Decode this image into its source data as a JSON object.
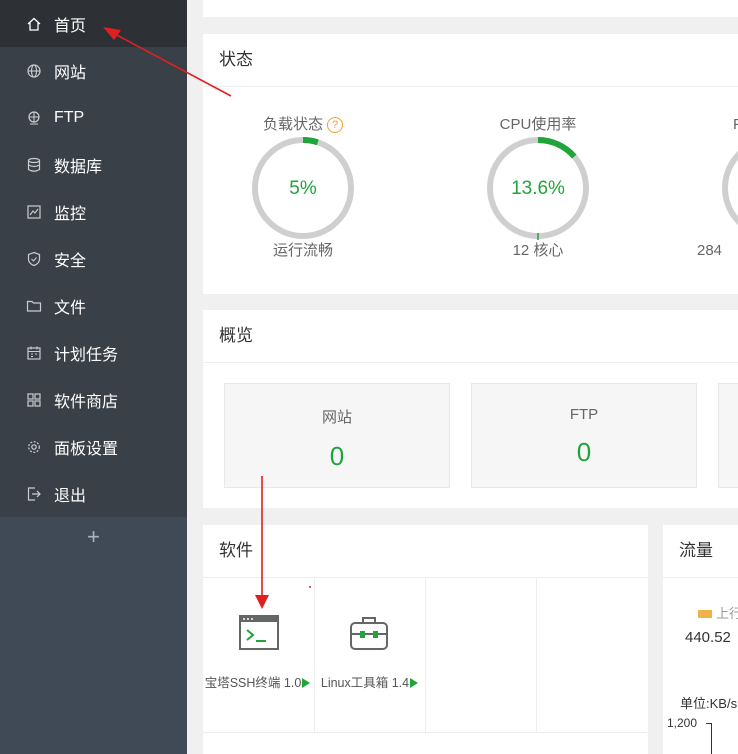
{
  "sidebar": {
    "items": [
      {
        "label": "首页",
        "icon": "home-icon"
      },
      {
        "label": "网站",
        "icon": "globe-icon"
      },
      {
        "label": "FTP",
        "icon": "ftp-icon"
      },
      {
        "label": "数据库",
        "icon": "database-icon"
      },
      {
        "label": "监控",
        "icon": "monitor-icon"
      },
      {
        "label": "安全",
        "icon": "shield-icon"
      },
      {
        "label": "文件",
        "icon": "folder-icon"
      },
      {
        "label": "计划任务",
        "icon": "calendar-icon"
      },
      {
        "label": "软件商店",
        "icon": "grid-icon"
      },
      {
        "label": "面板设置",
        "icon": "gear-icon"
      },
      {
        "label": "退出",
        "icon": "logout-icon"
      }
    ],
    "add_label": "+"
  },
  "status": {
    "title": "状态",
    "load": {
      "label": "负载状态",
      "help": "?",
      "value": "5%",
      "sub": "运行流畅",
      "percent": 5
    },
    "cpu": {
      "label": "CPU使用率",
      "value": "13.6%",
      "sub": "12 核心",
      "percent": 13.6
    },
    "third": {
      "label": "F",
      "sub": "284"
    }
  },
  "overview": {
    "title": "概览",
    "cards": [
      {
        "label": "网站",
        "value": "0"
      },
      {
        "label": "FTP",
        "value": "0"
      }
    ]
  },
  "software": {
    "title": "软件",
    "items": [
      {
        "name": "宝塔SSH终端 1.0",
        "icon": "terminal-icon"
      },
      {
        "name": "Linux工具箱 1.4",
        "icon": "toolbox-icon"
      }
    ]
  },
  "traffic": {
    "title": "流量",
    "legend_up": "上行",
    "up_value": "440.52",
    "unit": "单位:KB/s",
    "y_tick": "1,200"
  },
  "colors": {
    "accent": "#20a53a",
    "arrow": "#e02020",
    "sidebar": "#3a4048"
  }
}
